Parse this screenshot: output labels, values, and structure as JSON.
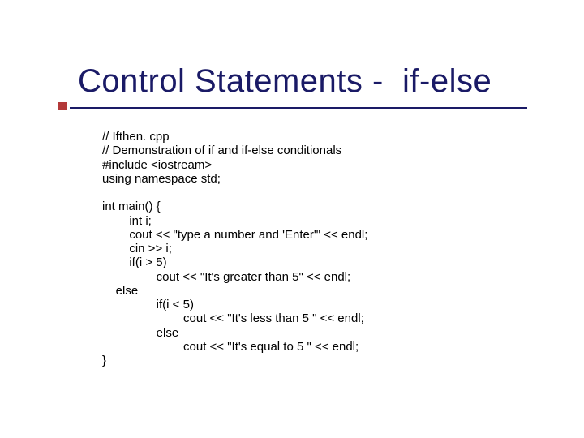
{
  "title": "Control Statements -  if-else",
  "code": "// Ifthen. cpp\n// Demonstration of if and if-else conditionals\n#include <iostream>\nusing namespace std;\n\nint main() {\n        int i;\n        cout << \"type a number and 'Enter'\" << endl;\n        cin >> i;\n        if(i > 5)\n                cout << \"It's greater than 5\" << endl;\n    else\n                if(i < 5)\n                        cout << \"It's less than 5 \" << endl;\n                else\n                        cout << \"It's equal to 5 \" << endl;\n}"
}
